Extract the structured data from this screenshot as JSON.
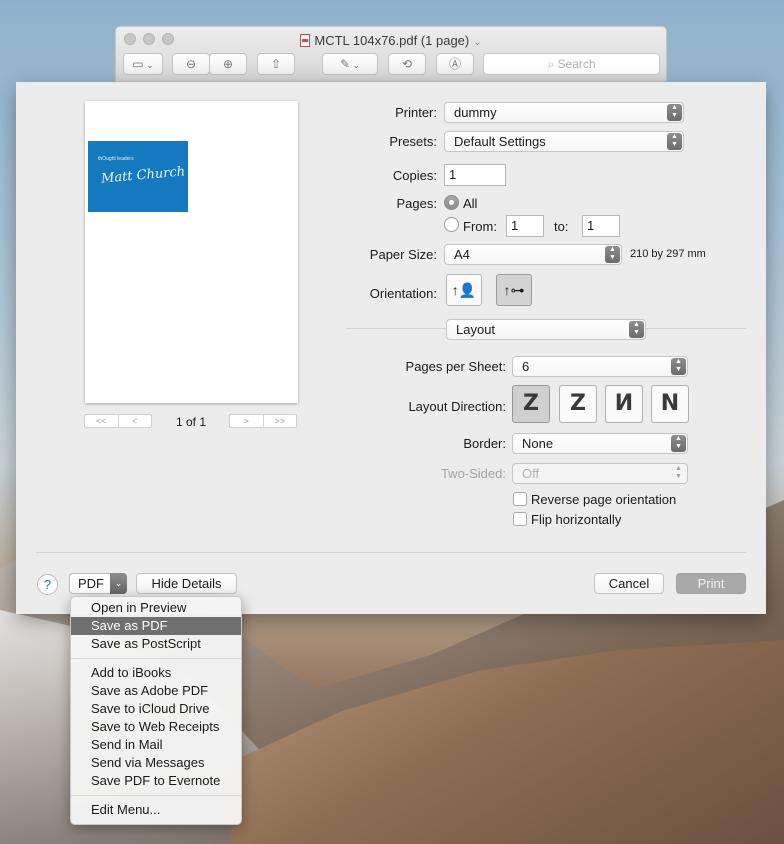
{
  "window": {
    "title": "MCTL 104x76.pdf (1 page)",
    "search_placeholder": "Search"
  },
  "preview": {
    "card_small_text": "thOught leaders",
    "card_name": "Matt Church",
    "page_count": "1 of 1",
    "first_label": "<<",
    "prev_label": "<",
    "next_label": ">",
    "last_label": ">>"
  },
  "form": {
    "printer_label": "Printer:",
    "printer_value": "dummy",
    "presets_label": "Presets:",
    "presets_value": "Default Settings",
    "copies_label": "Copies:",
    "copies_value": "1",
    "pages_label": "Pages:",
    "pages_all": "All",
    "pages_from_label": "From:",
    "pages_from_value": "1",
    "pages_to_label": "to:",
    "pages_to_value": "1",
    "paper_label": "Paper Size:",
    "paper_value": "A4",
    "paper_dims": "210 by 297 mm",
    "orientation_label": "Orientation:",
    "section_value": "Layout",
    "pps_label": "Pages per Sheet:",
    "pps_value": "6",
    "direction_label": "Layout Direction:",
    "border_label": "Border:",
    "border_value": "None",
    "twosided_label": "Two-Sided:",
    "twosided_value": "Off",
    "reverse_label": "Reverse page orientation",
    "flip_label": "Flip horizontally"
  },
  "footer": {
    "help": "?",
    "pdf": "PDF",
    "hide_details": "Hide Details",
    "cancel": "Cancel",
    "print": "Print"
  },
  "pdf_menu": {
    "group1": [
      "Open in Preview",
      "Save as PDF",
      "Save as PostScript"
    ],
    "highlighted": "Save as PDF",
    "group2": [
      "Add to iBooks",
      "Save as Adobe PDF",
      "Save to iCloud Drive",
      "Save to Web Receipts",
      "Send in Mail",
      "Send via Messages",
      "Save PDF to Evernote"
    ],
    "group3": [
      "Edit Menu..."
    ]
  }
}
